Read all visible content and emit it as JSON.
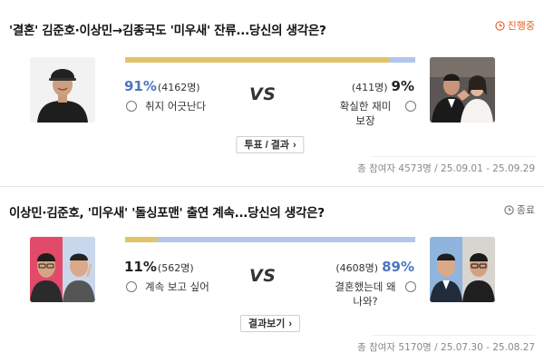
{
  "polls": [
    {
      "title": "'결혼' 김준호·이상민→김종국도 '미우새' 잔류...당신의 생각은?",
      "status": "진행중",
      "status_color": "#e0632a",
      "status_icon": "clock-icon",
      "left": {
        "percent": "91%",
        "count": "(4162명)",
        "label": "취지 어긋난다",
        "photo": "man-in-black-cap-photo"
      },
      "right": {
        "percent": "9%",
        "count": "(411명)",
        "label": "확실한 재미 보장",
        "photo": "wedding-couple-photo"
      },
      "vs": "VS",
      "bar_left_fraction": 0.91,
      "action_label": "투표 / 결과",
      "stats": "총 참여자 4573명 / 25.09.01 - 25.09.29"
    },
    {
      "title": "이상민·김준호, '미우새' '돌싱포맨' 출연 계속...당신의 생각은?",
      "status": "종료",
      "status_color": "#666666",
      "status_icon": "clock-icon",
      "left": {
        "percent": "11%",
        "count": "(562명)",
        "label": "계속 보고 싶어",
        "photo": "two-men-v-sign-photo"
      },
      "right": {
        "percent": "89%",
        "count": "(4608명)",
        "label": "결혼했는데 왜 나와?",
        "photo": "two-men-suits-photo"
      },
      "vs": "VS",
      "bar_left_fraction": 0.11,
      "action_label": "결과보기",
      "stats": "총 참여자 5170명 / 25.07.30 - 25.08.27"
    }
  ],
  "colors": {
    "bar_left": "#e0c468",
    "bar_right": "#b2c6e9",
    "percent_highlight": "#4a75c4"
  }
}
